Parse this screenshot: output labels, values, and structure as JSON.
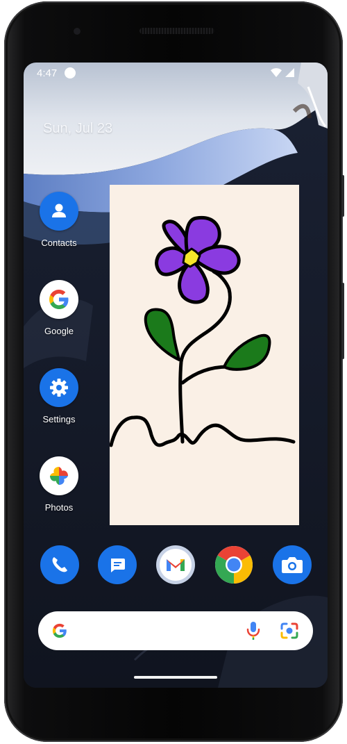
{
  "status_bar": {
    "time": "4:47"
  },
  "home": {
    "date": "Sun, Jul 23"
  },
  "apps": [
    {
      "label": "Contacts",
      "icon": "contacts-icon"
    },
    {
      "label": "Google",
      "icon": "google-icon"
    },
    {
      "label": "Settings",
      "icon": "settings-gear-icon"
    },
    {
      "label": "Photos",
      "icon": "photos-pinwheel-icon"
    }
  ],
  "dock": [
    {
      "icon": "phone-icon"
    },
    {
      "icon": "messages-icon"
    },
    {
      "icon": "gmail-icon"
    },
    {
      "icon": "chrome-icon"
    },
    {
      "icon": "camera-icon"
    }
  ],
  "search_bar": {
    "icons": [
      "google-g-icon",
      "microphone-icon",
      "google-lens-icon"
    ]
  },
  "widget": {
    "content": "flower-drawing",
    "colors": {
      "petals": "#8a3be0",
      "center": "#f5e52a",
      "leaves": "#1b7a1b",
      "background": "#faf0e6"
    }
  },
  "colors": {
    "accent_blue": "#1a73e8",
    "google_red": "#ea4335",
    "google_yellow": "#fbbc04",
    "google_green": "#34a853"
  }
}
